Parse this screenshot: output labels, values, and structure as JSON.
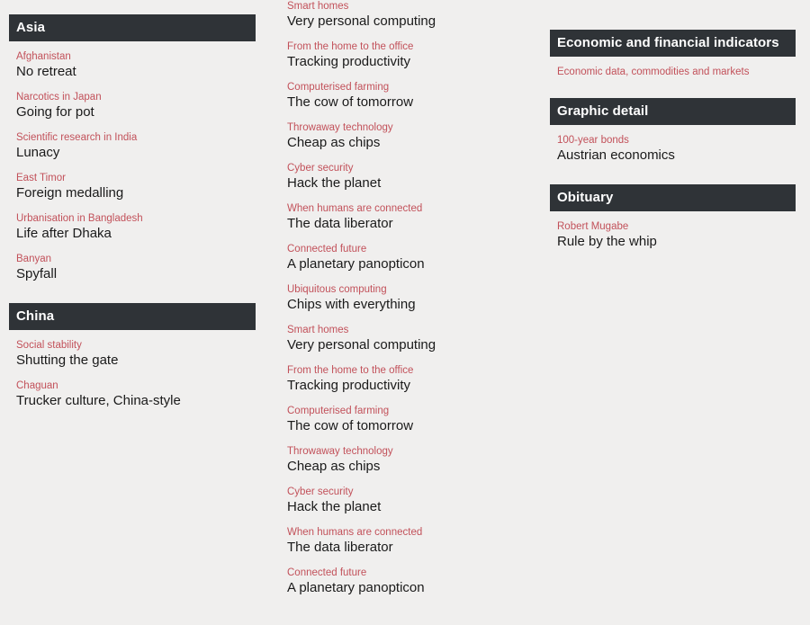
{
  "colors": {
    "page_background": "#f0efee",
    "header_bar": "#2f3337",
    "header_text": "#ffffff",
    "kicker": "#c2515a",
    "headline": "#1a1a1a"
  },
  "columns": {
    "left": {
      "sections": [
        {
          "title": "Asia",
          "articles": [
            {
              "kicker": "Afghanistan",
              "headline": "No retreat"
            },
            {
              "kicker": "Narcotics in Japan",
              "headline": "Going for pot"
            },
            {
              "kicker": "Scientific research in India",
              "headline": "Lunacy"
            },
            {
              "kicker": "East Timor",
              "headline": "Foreign medalling"
            },
            {
              "kicker": "Urbanisation in Bangladesh",
              "headline": "Life after Dhaka"
            },
            {
              "kicker": "Banyan",
              "headline": "Spyfall"
            }
          ]
        },
        {
          "title": "China",
          "articles": [
            {
              "kicker": "Social stability",
              "headline": "Shutting the gate"
            },
            {
              "kicker": "Chaguan",
              "headline": "Trucker culture, China-style"
            }
          ]
        }
      ]
    },
    "middle": {
      "articles": [
        {
          "kicker": "Smart homes",
          "headline": "Very personal computing"
        },
        {
          "kicker": "From the home to the office",
          "headline": "Tracking productivity"
        },
        {
          "kicker": "Computerised farming",
          "headline": "The cow of tomorrow"
        },
        {
          "kicker": "Throwaway technology",
          "headline": "Cheap as chips"
        },
        {
          "kicker": "Cyber security",
          "headline": "Hack the planet"
        },
        {
          "kicker": "When humans are connected",
          "headline": "The data liberator"
        },
        {
          "kicker": "Connected future",
          "headline": "A planetary panopticon"
        },
        {
          "kicker": "Ubiquitous computing",
          "headline": "Chips with everything"
        },
        {
          "kicker": "Smart homes",
          "headline": "Very personal computing"
        },
        {
          "kicker": "From the home to the office",
          "headline": "Tracking productivity"
        },
        {
          "kicker": "Computerised farming",
          "headline": "The cow of tomorrow"
        },
        {
          "kicker": "Throwaway technology",
          "headline": "Cheap as chips"
        },
        {
          "kicker": "Cyber security",
          "headline": "Hack the planet"
        },
        {
          "kicker": "When humans are connected",
          "headline": "The data liberator"
        },
        {
          "kicker": "Connected future",
          "headline": "A planetary panopticon"
        }
      ]
    },
    "right": {
      "sections": [
        {
          "title": "Economic and financial indicators",
          "articles": [
            {
              "kicker": "Economic data, commodities and markets",
              "headline": ""
            }
          ]
        },
        {
          "title": "Graphic detail",
          "articles": [
            {
              "kicker": "100-year bonds",
              "headline": "Austrian economics"
            }
          ]
        },
        {
          "title": "Obituary",
          "articles": [
            {
              "kicker": "Robert Mugabe",
              "headline": "Rule by the whip"
            }
          ]
        }
      ]
    }
  }
}
